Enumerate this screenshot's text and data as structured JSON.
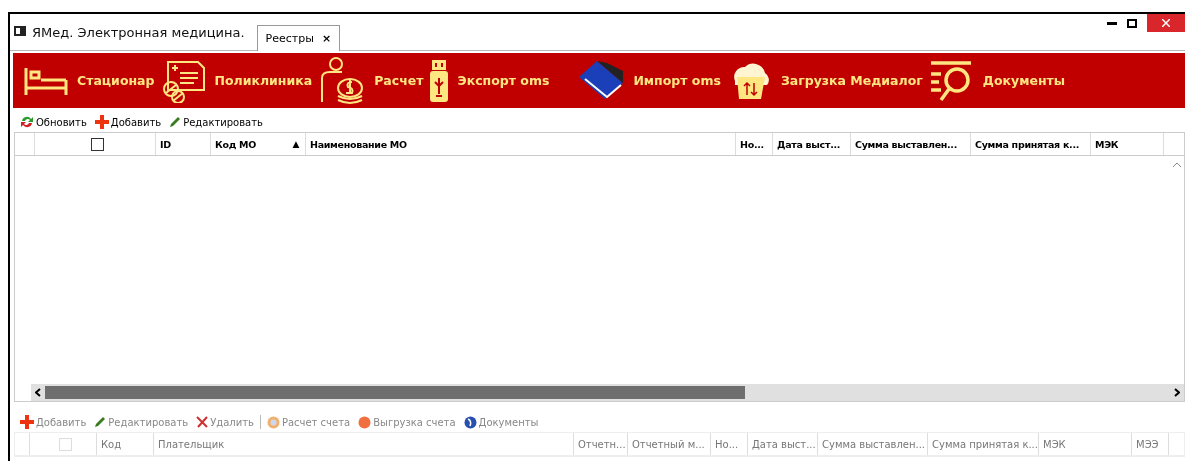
{
  "window": {
    "title": "ЯМед. Электронная медицина."
  },
  "tabs": [
    {
      "label": "Реестры",
      "close": "×",
      "selected": true
    }
  ],
  "modules": [
    {
      "label": "Стационар"
    },
    {
      "label": "Поликлиника"
    },
    {
      "label": "Расчет"
    },
    {
      "label": "Экспорт oms"
    },
    {
      "label": "Импорт oms"
    },
    {
      "label": "Загрузка Медиалог"
    },
    {
      "label": "Документы"
    }
  ],
  "toolbar": [
    {
      "label": "Обновить",
      "disabled": false
    },
    {
      "label": "Добавить",
      "disabled": false
    },
    {
      "label": "Редактировать",
      "disabled": false
    }
  ],
  "registry_table": {
    "select_all": {
      "checked": false
    },
    "columns": [
      {
        "label": "ID"
      },
      {
        "label": "Код МО",
        "sort": "▲"
      },
      {
        "label": "Наименование МО"
      },
      {
        "label": "Но..."
      },
      {
        "label": "Дата выст..."
      },
      {
        "label": "Сумма выставлен..."
      },
      {
        "label": "Сумма принятая к..."
      },
      {
        "label": "МЭК"
      }
    ]
  },
  "bills_toolbar": [
    {
      "kind": "button",
      "label": "Добавить",
      "disabled": true
    },
    {
      "kind": "button",
      "label": "Редактировать",
      "disabled": true
    },
    {
      "kind": "button",
      "label": "Удалить",
      "disabled": true
    },
    {
      "kind": "separator"
    },
    {
      "kind": "button",
      "label": "Расчет счета",
      "disabled": true
    },
    {
      "kind": "button",
      "label": "Выгрузка счета",
      "disabled": true
    },
    {
      "kind": "button",
      "label": "Документы",
      "disabled": true
    }
  ],
  "bills_table": {
    "select_all": {
      "checked": false
    },
    "columns": [
      {
        "label": "Код"
      },
      {
        "label": "Плательщик"
      },
      {
        "label": "Отчетн..."
      },
      {
        "label": "Отчетный м..."
      },
      {
        "label": "Но..."
      },
      {
        "label": "Дата выст..."
      },
      {
        "label": "Сумма выставлен..."
      },
      {
        "label": "Сумма принятая к..."
      },
      {
        "label": "МЭК"
      },
      {
        "label": "МЭЭ"
      }
    ]
  }
}
